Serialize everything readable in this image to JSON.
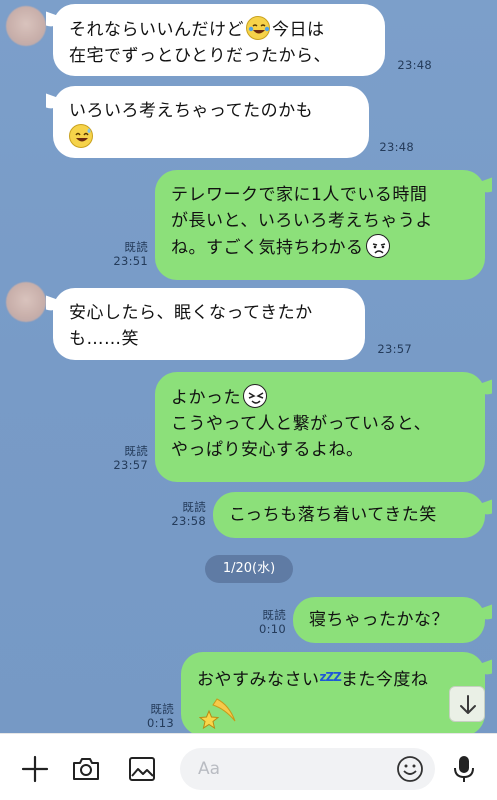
{
  "messages": [
    {
      "side": "received",
      "lines": [
        "それならいいんだけど",
        "今日は",
        "在宅でずっとひとりだったから、"
      ],
      "time": "23:48"
    },
    {
      "side": "received",
      "lines": [
        "いろいろ考えちゃってたのかも"
      ],
      "time": "23:48"
    },
    {
      "side": "sent",
      "lines": [
        "テレワークで家に1人でいる時間",
        "が長いと、いろいろ考えちゃうよ",
        "ね。すごく気持ちわかる"
      ],
      "read": "既読",
      "time": "23:51"
    },
    {
      "side": "received",
      "lines": [
        "安心したら、眠くなってきたか",
        "も……笑"
      ],
      "time": "23:57"
    },
    {
      "side": "sent",
      "lines": [
        "よかった",
        "こうやって人と繋がっていると、",
        "やっぱり安心するよね。"
      ],
      "read": "既読",
      "time": "23:57"
    },
    {
      "side": "sent",
      "lines": [
        "こっちも落ち着いてきた笑"
      ],
      "read": "既読",
      "time": "23:58"
    },
    {
      "side": "sent",
      "lines": [
        "寝ちゃったかな？"
      ],
      "read": "既読",
      "time": "0:10"
    },
    {
      "side": "sent",
      "lines": [
        "おやすみなさい",
        "zZZ",
        "また今度ね"
      ],
      "read": "既読",
      "time": "0:13"
    }
  ],
  "date_separator": "1/20(水)",
  "input": {
    "placeholder": "Aa"
  },
  "icons": {
    "emoji_laugh_tears": "face-with-tears-of-joy-icon",
    "emoji_sweat_smile": "grinning-face-with-sweat-icon",
    "emoji_sad": "sad-face-sticker-icon",
    "emoji_squint": "squinting-face-sticker-icon",
    "shooting_star": "shooting-star-icon",
    "toolbar": [
      "plus-icon",
      "camera-icon",
      "image-icon",
      "smiley-icon",
      "microphone-icon"
    ],
    "scroll": "arrow-down-icon"
  },
  "colors": {
    "sent_bubble": "#8ce07a",
    "received_bubble": "#ffffff",
    "background": "#7a9dc9"
  }
}
